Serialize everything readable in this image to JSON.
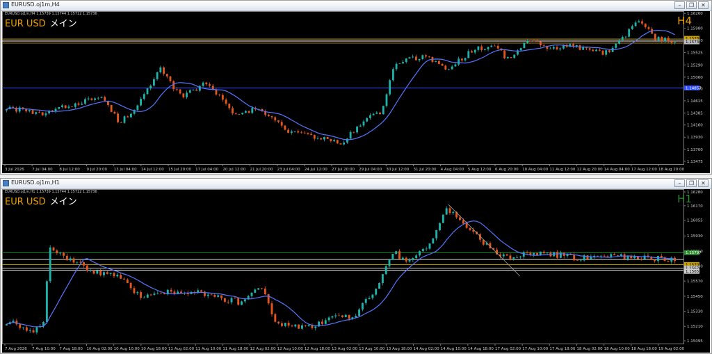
{
  "top": {
    "window_title": "EURUSD.oj1m,H4",
    "chart_header": "EURUSD.oj1m,H4 1.15739 1.15744 1.15712 1.15736",
    "symbol": "EUR USD",
    "symbol_suffix": "メイン",
    "timeframe": "H4",
    "timeframe_color": "#f0a000",
    "price_min": 1.13475,
    "price_max": 1.1625,
    "price_axis": [
      "1.16260",
      "1.15980",
      "1.15750",
      "1.15525",
      "1.15290",
      "1.15060",
      "1.14840",
      "1.14615",
      "1.14385",
      "1.14160",
      "1.13930",
      "1.13700",
      "1.13475"
    ],
    "time_axis": [
      "3 Jul 2026",
      "7 Jul 04:00",
      "8 Jul 12:00",
      "9 Jul 20:00",
      "13 Jul 04:00",
      "14 Jul 12:00",
      "15 Jul 20:00",
      "17 Jul 04:00",
      "20 Jul 12:00",
      "21 Jul 20:00",
      "23 Jul 04:00",
      "24 Jul 12:00",
      "27 Jul 20:00",
      "29 Jul 04:00",
      "30 Jul 12:00",
      "31 Jul 20:00",
      "4 Aug 04:00",
      "5 Aug 12:00",
      "6 Aug 20:00",
      "10 Aug 04:00",
      "11 Aug 12:00",
      "12 Aug 20:00",
      "14 Aug 04:00",
      "17 Aug 12:00",
      "18 Aug 20:00"
    ],
    "levels": [
      {
        "price": 1.15777,
        "color": "#c8a000"
      },
      {
        "price": 1.1574,
        "color": "#ffffff"
      },
      {
        "price": 1.157,
        "color": "#b08000"
      },
      {
        "price": 1.14857,
        "color": "#3050ff"
      }
    ],
    "price_tags": [
      {
        "text": "1.15787",
        "price": 1.1579,
        "bg": "#c8a000",
        "fg": "#000000"
      },
      {
        "text": "1.15736",
        "price": 1.15725,
        "bg": "#c0c0c0",
        "fg": "#000000"
      },
      {
        "text": "1.14857",
        "price": 1.14857,
        "bg": "#3050ff",
        "fg": "#ffffff"
      }
    ]
  },
  "bottom": {
    "window_title": "EURUSD.oj1m,H1",
    "chart_header": "EURUSD.oj1m,H1 1.15739 1.15744 1.15712 1.15736",
    "symbol": "EUR USD",
    "symbol_suffix": "メイン",
    "timeframe": "H1",
    "timeframe_color": "#2e8b2e",
    "price_min": 1.15095,
    "price_max": 1.1628,
    "price_axis": [
      "1.16280",
      "1.16170",
      "1.16055",
      "1.15930",
      "1.15810",
      "1.15690",
      "1.15570",
      "1.15450",
      "1.15330",
      "1.15210",
      "1.15095"
    ],
    "time_axis": [
      "7 Aug 2026",
      "7 Aug 10:00",
      "7 Aug 18:00",
      "10 Aug 02:00",
      "10 Aug 10:00",
      "10 Aug 18:00",
      "11 Aug 02:00",
      "11 Aug 10:00",
      "11 Aug 18:00",
      "12 Aug 02:00",
      "12 Aug 10:00",
      "12 Aug 18:00",
      "13 Aug 02:00",
      "13 Aug 10:00",
      "13 Aug 18:00",
      "14 Aug 02:00",
      "14 Aug 10:00",
      "14 Aug 18:00",
      "17 Aug 02:00",
      "17 Aug 10:00",
      "17 Aug 18:00",
      "18 Aug 02:00",
      "18 Aug 10:00",
      "18 Aug 18:00",
      "19 Aug 02:00"
    ],
    "levels": [
      {
        "price": 1.15797,
        "color": "#2e8b2e"
      },
      {
        "price": 1.15742,
        "color": "#d0d0d0"
      },
      {
        "price": 1.15702,
        "color": "#c8a000"
      },
      {
        "price": 1.15674,
        "color": "#d0d0d0"
      },
      {
        "price": 1.15657,
        "color": "#d0d0d0"
      }
    ],
    "price_tags": [
      {
        "text": "1.15797",
        "price": 1.15797,
        "bg": "#2e8b2e",
        "fg": "#ffffff"
      },
      {
        "text": "1.15702",
        "price": 1.15702,
        "bg": "#c8a000",
        "fg": "#000000"
      },
      {
        "text": "1.15674",
        "price": 1.15674,
        "bg": "#c0c0c0",
        "fg": "#000000"
      },
      {
        "text": "1.15657",
        "price": 1.15648,
        "bg": "#d0d0d0",
        "fg": "#000000"
      }
    ],
    "trendline": {
      "from": [
        0.655,
        1.1618
      ],
      "to": [
        0.76,
        1.1561
      ]
    }
  },
  "colors": {
    "bull": "#20b2aa",
    "bear": "#e2571e",
    "ma": "#5577ff"
  }
}
